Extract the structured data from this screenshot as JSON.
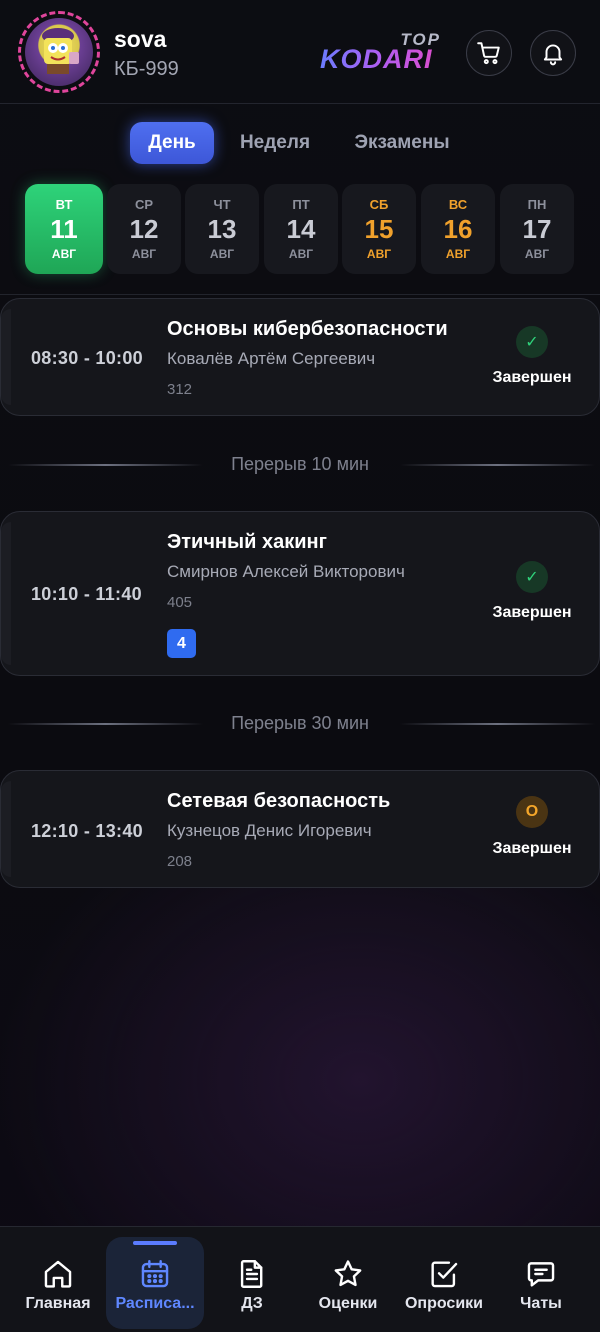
{
  "profile": {
    "username": "sova",
    "group": "КБ-999"
  },
  "brand": {
    "top": "TOP",
    "name": "KODARI"
  },
  "tabs": [
    {
      "label": "День",
      "active": true
    },
    {
      "label": "Неделя",
      "active": false
    },
    {
      "label": "Экзамены",
      "active": false
    }
  ],
  "dates": [
    {
      "dow": "ВТ",
      "day": "11",
      "month": "АВГ",
      "active": true,
      "weekend": false
    },
    {
      "dow": "СР",
      "day": "12",
      "month": "АВГ",
      "active": false,
      "weekend": false
    },
    {
      "dow": "ЧТ",
      "day": "13",
      "month": "АВГ",
      "active": false,
      "weekend": false
    },
    {
      "dow": "ПТ",
      "day": "14",
      "month": "АВГ",
      "active": false,
      "weekend": false
    },
    {
      "dow": "СБ",
      "day": "15",
      "month": "АВГ",
      "active": false,
      "weekend": true
    },
    {
      "dow": "ВС",
      "day": "16",
      "month": "АВГ",
      "active": false,
      "weekend": true
    },
    {
      "dow": "ПН",
      "day": "17",
      "month": "АВГ",
      "active": false,
      "weekend": false
    }
  ],
  "lessons": [
    {
      "time": "08:30 - 10:00",
      "subject": "Основы кибербезопасности",
      "teacher": "Ковалёв Артём Сергеевич",
      "room": "312",
      "status_icon": "✓",
      "status": "Завершен"
    },
    {
      "time": "10:10 - 11:40",
      "subject": "Этичный хакинг",
      "teacher": "Смирнов Алексей Викторович",
      "room": "405",
      "grade": "4",
      "status_icon": "✓",
      "status": "Завершен"
    },
    {
      "time": "12:10 - 13:40",
      "subject": "Сетевая безопасность",
      "teacher": "Кузнецов Денис Игоревич",
      "room": "208",
      "status_icon": "О",
      "status": "Завершен"
    }
  ],
  "breaks": [
    "Перерыв 10 мин",
    "Перерыв 30 мин"
  ],
  "nav": [
    {
      "label": "Главная",
      "icon": "home-icon"
    },
    {
      "label": "Расписа...",
      "icon": "calendar-icon",
      "active": true
    },
    {
      "label": "ДЗ",
      "icon": "document-icon"
    },
    {
      "label": "Оценки",
      "icon": "star-icon"
    },
    {
      "label": "Опросики",
      "icon": "checkbox-icon"
    },
    {
      "label": "Чаты",
      "icon": "chat-icon"
    }
  ],
  "colors": {
    "accent": "#4f6ff0",
    "active_day": "#2ed37a",
    "weekend": "#f0a12c",
    "done": "#2fd27b",
    "pending": "#f4a62a",
    "grade": "#2f6bf0"
  }
}
